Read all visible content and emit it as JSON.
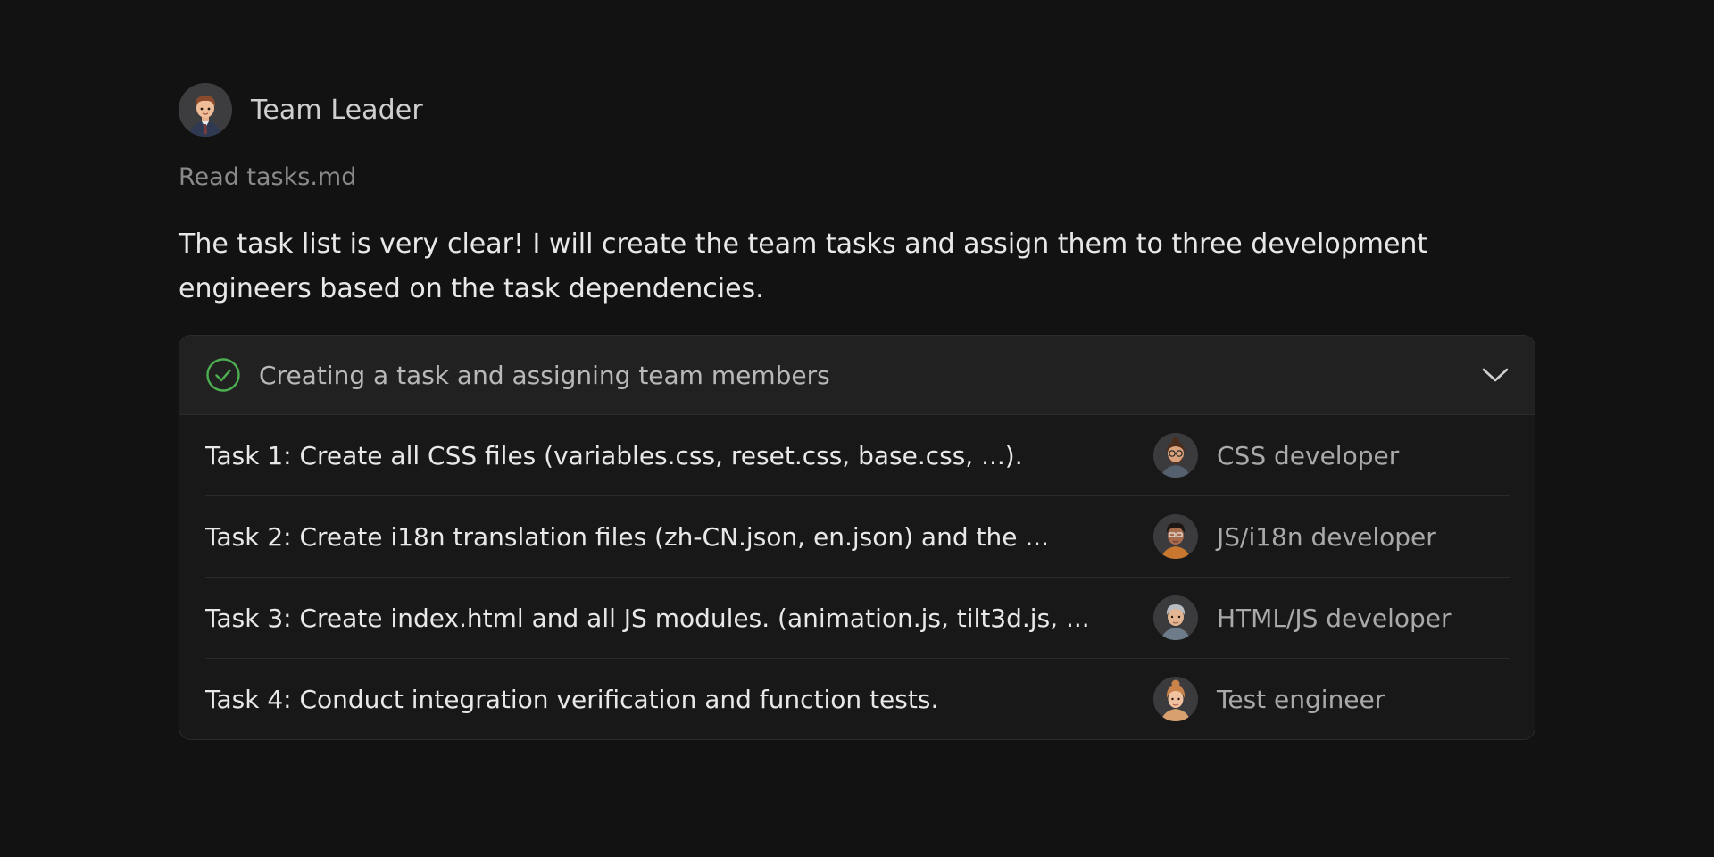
{
  "author": {
    "name": "Team Leader",
    "avatar_icon": "team-leader-avatar"
  },
  "tool_call": {
    "label": "Read tasks.md"
  },
  "message": {
    "text": "The task list is very clear! I will create the team tasks and assign them to three development engineers based on the task dependencies."
  },
  "task_card": {
    "title": "Creating a task and assigning team members",
    "status_icon": "check-circle-icon",
    "status_color": "#4caf50",
    "expand_icon": "chevron-down-icon",
    "tasks": [
      {
        "text": "Task 1: Create all CSS files (variables.css, reset.css, base.css, ...).",
        "assignee": "CSS developer",
        "avatar_icon": "css-developer-avatar"
      },
      {
        "text": "Task 2: Create i18n translation files (zh-CN.json, en.json) and the ...",
        "assignee": "JS/i18n developer",
        "avatar_icon": "js-i18n-developer-avatar"
      },
      {
        "text": "Task 3: Create index.html and all JS modules. (animation.js, tilt3d.js, ...",
        "assignee": "HTML/JS developer",
        "avatar_icon": "html-js-developer-avatar"
      },
      {
        "text": "Task 4: Conduct integration verification and function tests.",
        "assignee": "Test engineer",
        "avatar_icon": "test-engineer-avatar"
      }
    ]
  }
}
